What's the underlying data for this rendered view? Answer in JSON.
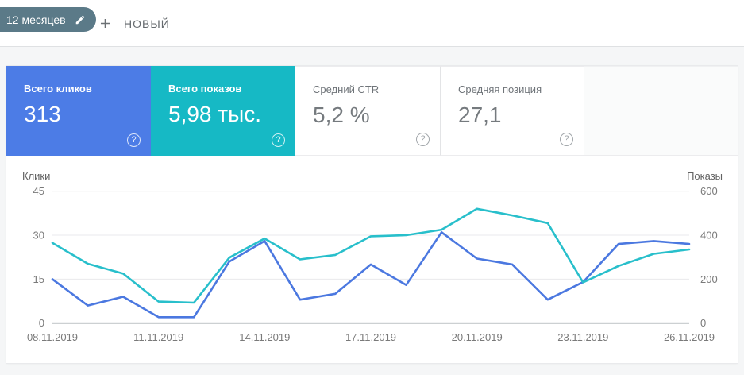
{
  "topbar": {
    "filter_chip_label": "12 месяцев",
    "new_button_label": "НОВЫЙ"
  },
  "ui": {
    "help_glyph": "?"
  },
  "metrics": [
    {
      "label": "Всего кликов",
      "value": "313",
      "selected": true,
      "color": "#4c7ce6"
    },
    {
      "label": "Всего показов",
      "value": "5,98 тыс.",
      "selected": true,
      "color": "#16b9c5"
    },
    {
      "label": "Средний CTR",
      "value": "5,2 %",
      "selected": false,
      "color": "#ffffff"
    },
    {
      "label": "Средняя позиция",
      "value": "27,1",
      "selected": false,
      "color": "#ffffff"
    }
  ],
  "chart_data": {
    "type": "line",
    "x": [
      "08.11.2019",
      "09.11.2019",
      "10.11.2019",
      "11.11.2019",
      "12.11.2019",
      "13.11.2019",
      "14.11.2019",
      "15.11.2019",
      "16.11.2019",
      "17.11.2019",
      "18.11.2019",
      "19.11.2019",
      "20.11.2019",
      "21.11.2019",
      "22.11.2019",
      "23.11.2019",
      "24.11.2019",
      "25.11.2019",
      "26.11.2019"
    ],
    "x_tick_labels": [
      "08.11.2019",
      "11.11.2019",
      "14.11.2019",
      "17.11.2019",
      "20.11.2019",
      "23.11.2019",
      "26.11.2019"
    ],
    "series": [
      {
        "name": "Клики",
        "axis": "left",
        "color": "#4b78e0",
        "values": [
          15,
          6,
          9,
          2,
          2,
          21,
          28,
          8,
          10,
          20,
          13,
          31,
          22,
          20,
          8,
          14,
          27,
          28,
          27
        ]
      },
      {
        "name": "Показы",
        "axis": "right",
        "color": "#28bfcb",
        "values": [
          365,
          270,
          225,
          98,
          93,
          298,
          385,
          290,
          310,
          395,
          400,
          425,
          520,
          490,
          455,
          185,
          260,
          315,
          335
        ]
      }
    ],
    "left_axis": {
      "label": "Клики",
      "ticks": [
        0,
        15,
        30,
        45
      ],
      "range": [
        0,
        45
      ]
    },
    "right_axis": {
      "label": "Показы",
      "ticks": [
        0,
        200,
        400,
        600
      ],
      "range": [
        0,
        600
      ]
    },
    "grid": true,
    "legend_position": "none"
  }
}
